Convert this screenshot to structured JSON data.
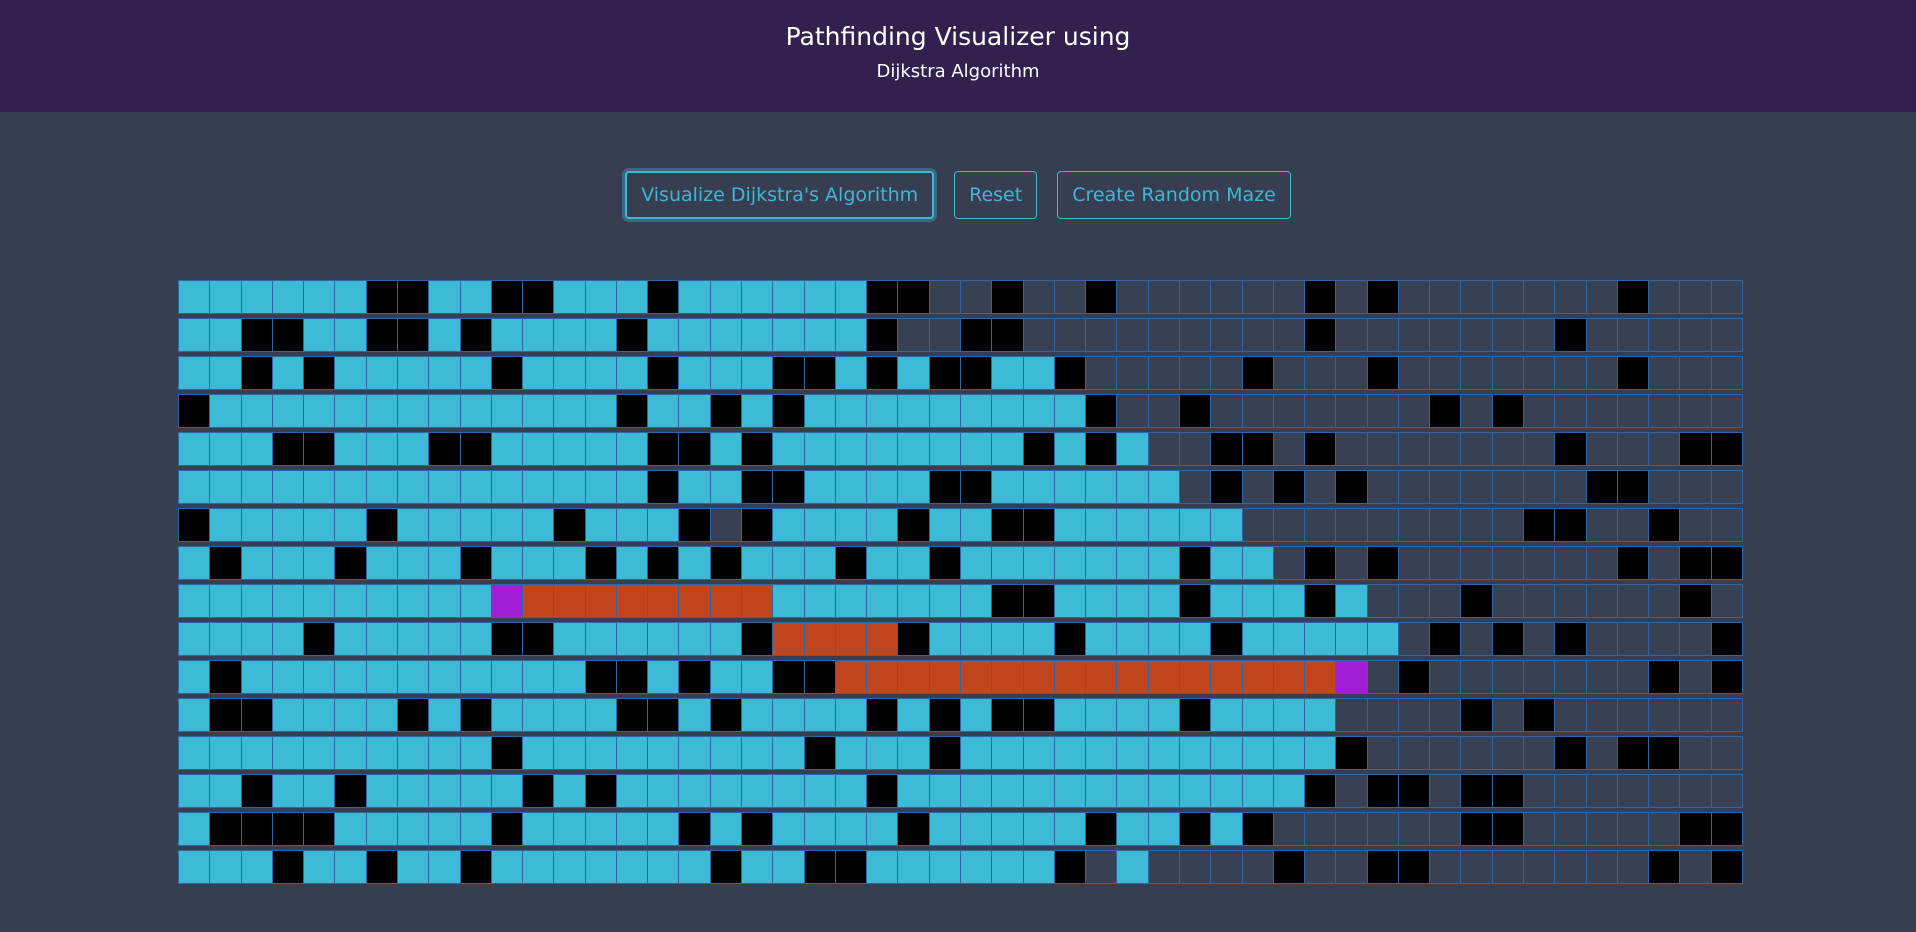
{
  "header": {
    "title": "Pathfinding Visualizer using",
    "subtitle": "Dijkstra Algorithm"
  },
  "controls": {
    "visualize_label": "Visualize Dijkstra's Algorithm",
    "reset_label": "Reset",
    "maze_label": "Create Random Maze"
  },
  "colors": {
    "header_bg": "#33204f",
    "page_bg": "#383e52",
    "accent": "#3cb8d5",
    "visited": "#3dbad6",
    "wall": "#000000",
    "path": "#c0461d",
    "endpoint": "#a21ed6",
    "unvisited": "#384153",
    "grid_line": "#2f67a6"
  },
  "grid": {
    "rows": 16,
    "cols": 50,
    "legend": {
      ".": "unvisited",
      "v": "visited",
      "#": "wall",
      "p": "path",
      "s": "start",
      "e": "end"
    },
    "cells": [
      "vvvvvv##vv##vvv#vvvvvv##..#..#......#.#.......#...#",
      "vv##vv##v#vvvv#vvvvvvv#..##.........#.......#.....#",
      "vv#v#vvvvv#vvvv#vvv##v#v##vv#.....#...#.......#....",
      "#vvvvvvvvvvvvv#vv#v#vvvvvvvvv#..#.......#.#........#",
      "vvv##vvv##vvvvv##v#vvvvvvvv#v#v..##.#.......#...##..",
      "vvvvvvvvvvvvvvv#vv##vvvv##vvvvvv.#.#.#.......##...##",
      "#vvvvv#vvvvv#vvv#.#vvvv#vv##vvvvvv.........##..#...##.",
      "v#vvv#vvv#vvv#v#v#vvv#vv#vvvvvvv#vv.#.#.......#.##.#.",
      "vvvvvvvvvvsppppppppvvvvvvv##vvvv#vvv#v...#......#...#.",
      "vvvv#vvvvv##vvvvvv#pppp#vvvv#vvvv#vvvvv.#.#.#....##...#",
      "v#vvvvvvvvvvv##v#vv##ppppppppppppppppe.#.......#.#...",
      "v##vvvv#v#vvvv##v#vvvv#v#v##vvvv#vvvv....#.#......#.#.",
      "vvvvvvvvvv#vvvvvvvvv#vvv#vvvvvvvvvvvv#......#.##..#..#.",
      "vv#vv#vvvvv#v#vvvvvvvv#vvvvvvvvvvvvv#.##.##.......#.",
      "v####vvvvv#vvvvv#v#vvvv#vvvvv#vv#v#......##.....##",
      "vvv#vv#vv#vvvvvvv#vv##vvvvvv#.v....#..##.......#.#.."
    ]
  }
}
